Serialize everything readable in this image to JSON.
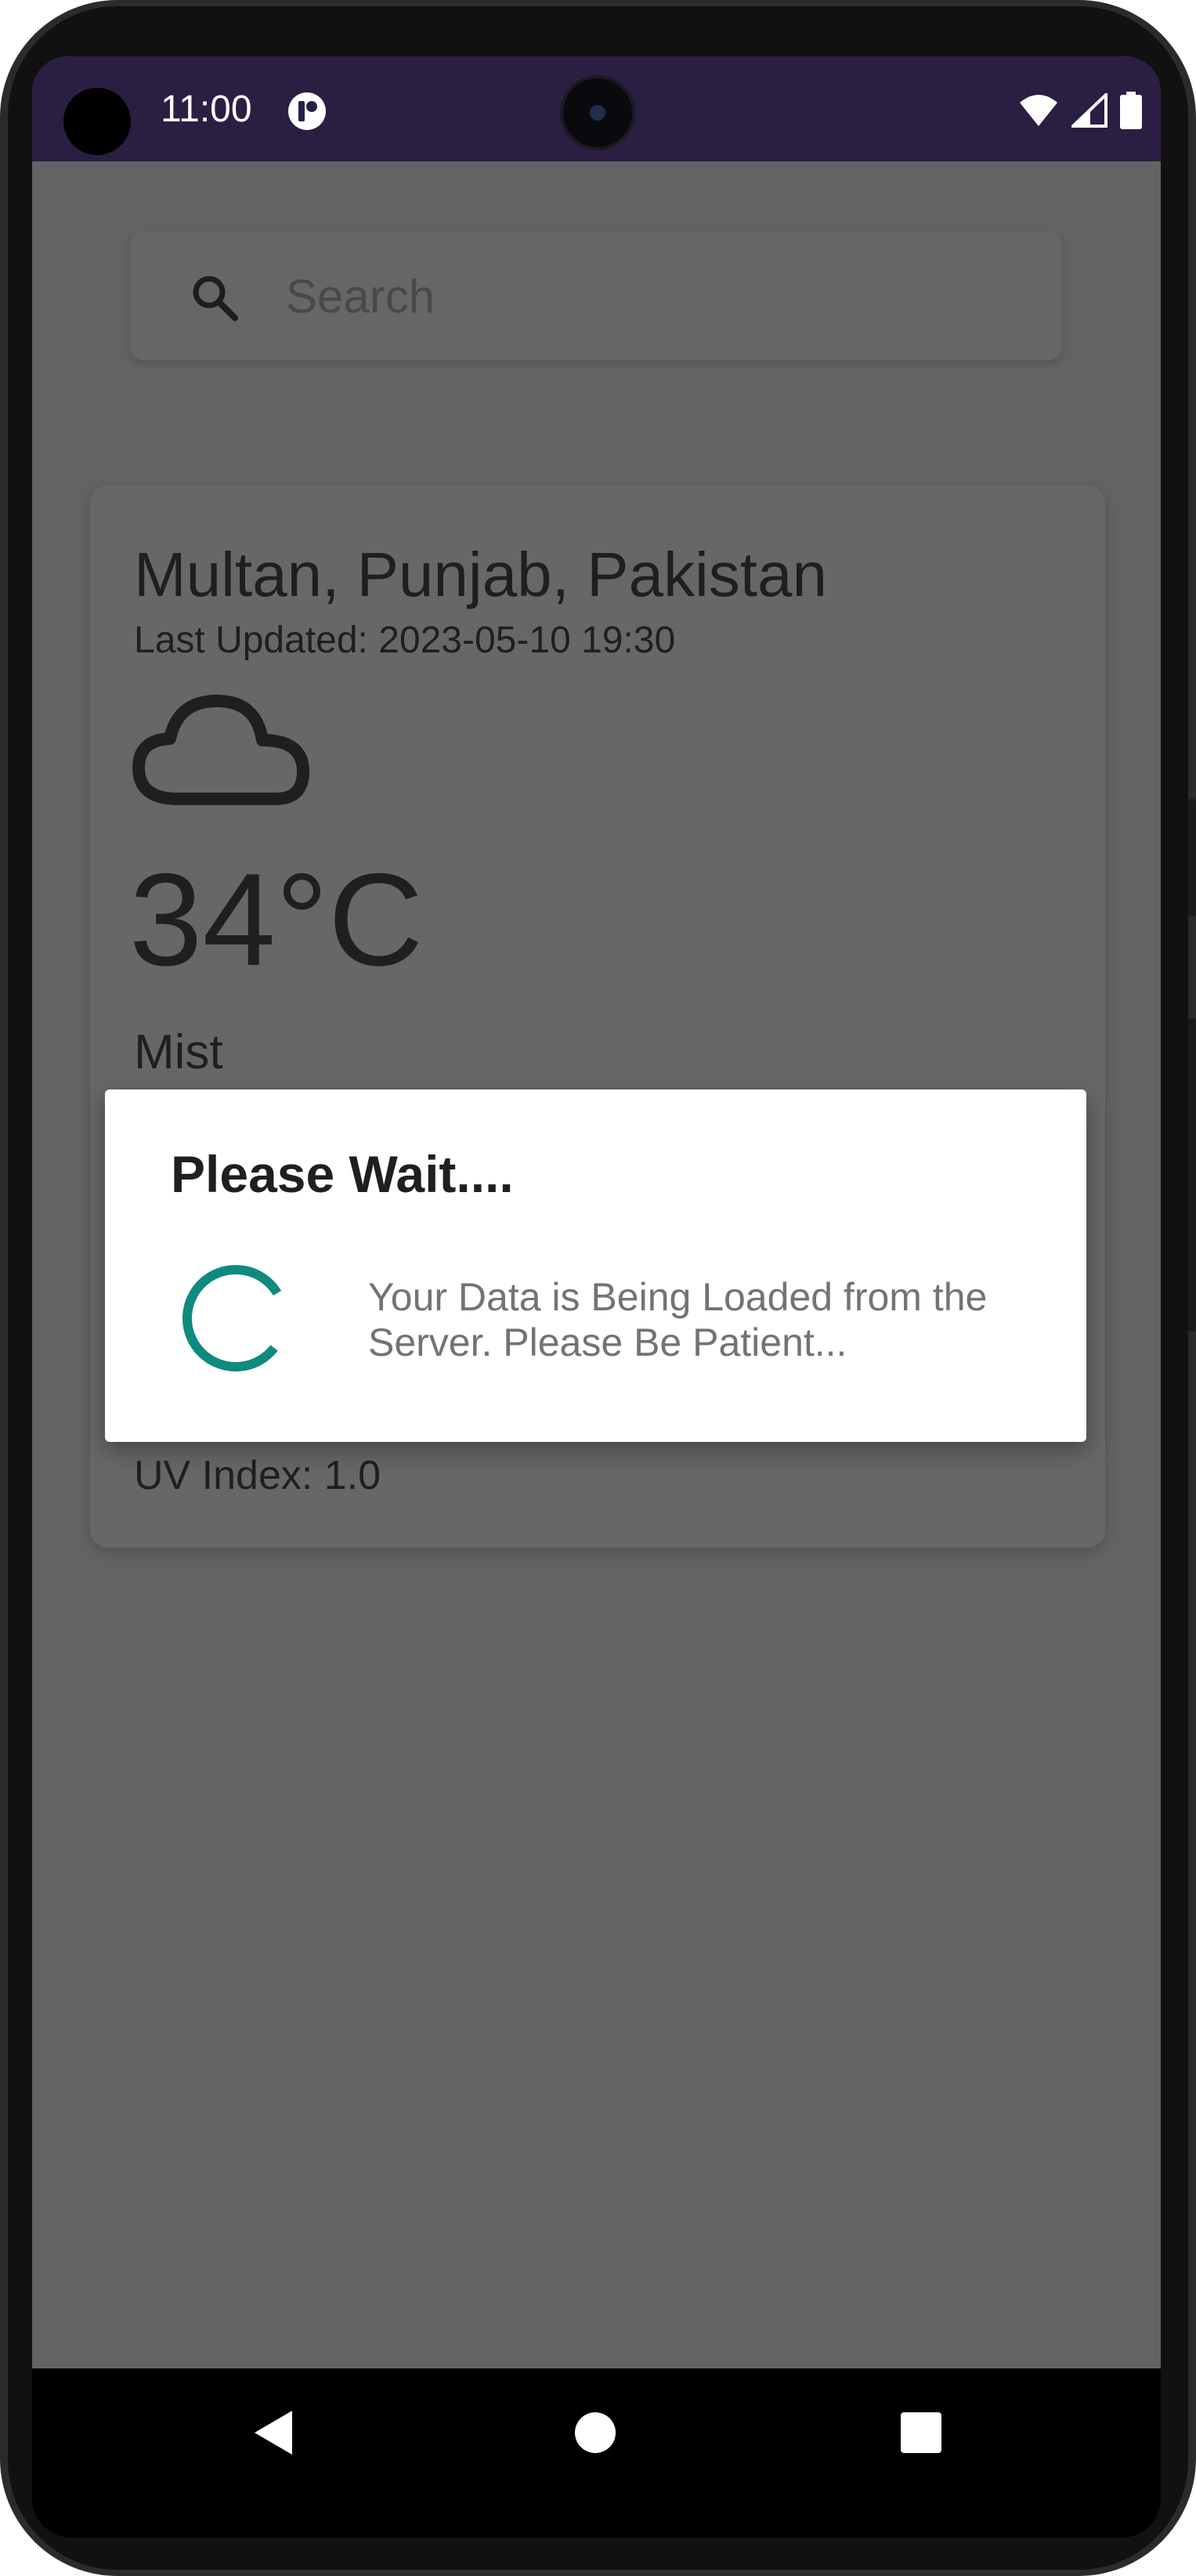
{
  "statusbar": {
    "time": "11:00",
    "icons": [
      "notification-app-icon",
      "wifi-icon",
      "signal-icon",
      "battery-icon"
    ]
  },
  "search": {
    "placeholder": "Search",
    "value": ""
  },
  "weather": {
    "location": "Multan, Punjab, Pakistan",
    "last_updated": "Last Updated: 2023-05-10 19:30",
    "icon": "cloud-icon",
    "temperature": "34°C",
    "condition": "Mist",
    "uv_index": "UV Index: 1.0"
  },
  "dialog": {
    "title": "Please Wait....",
    "message": "Your Data is Being Loaded from the Server. Please Be Patient...",
    "spinner_color": "#0f8a7e"
  },
  "navbar": {
    "buttons": [
      "back-icon",
      "home-icon",
      "recents-icon"
    ]
  },
  "colors": {
    "statusbar": "#2a1f43",
    "scrim_background": "#646264",
    "accent": "#0f8a7e"
  }
}
